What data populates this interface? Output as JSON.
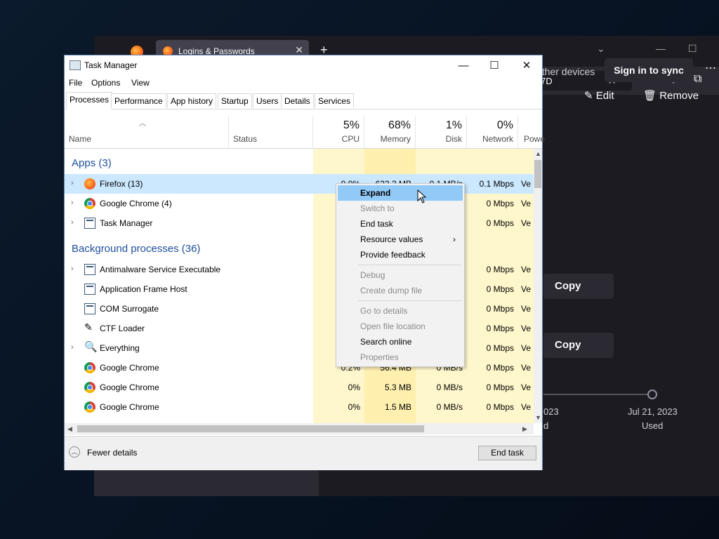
{
  "firefox": {
    "tab_title": "Logins & Passwords",
    "url_fragment": "7D",
    "other_devices": "other devices",
    "sign_in_sync": "Sign in to sync",
    "edit": "Edit",
    "remove": "Remove",
    "copy1": "Copy",
    "copy2": "Copy",
    "date_left": "023",
    "date_left_sub": "d",
    "date_right": "Jul 21, 2023",
    "date_right_sub": "Used"
  },
  "taskmanager": {
    "title": "Task Manager",
    "menu": [
      "File",
      "Options",
      "View"
    ],
    "tabs": [
      "Processes",
      "Performance",
      "App history",
      "Startup",
      "Users",
      "Details",
      "Services"
    ],
    "columns": {
      "name": "Name",
      "status": "Status",
      "cpu_pct": "5%",
      "cpu": "CPU",
      "mem_pct": "68%",
      "mem": "Memory",
      "disk_pct": "1%",
      "disk": "Disk",
      "net_pct": "0%",
      "net": "Network",
      "power": "Powe"
    },
    "group_apps": "Apps (3)",
    "group_bg": "Background processes (36)",
    "rows": [
      {
        "name": "Firefox (13)",
        "cpu": "0.0%",
        "mem": "633.3 MB",
        "disk": "0.1 MB/s",
        "net": "0.1 Mbps",
        "power": "Ve"
      },
      {
        "name": "Google Chrome (4)",
        "cpu": "",
        "mem": "",
        "disk": "",
        "net": "0 Mbps",
        "power": "Ve"
      },
      {
        "name": "Task Manager",
        "cpu": "",
        "mem": "",
        "disk": "",
        "net": "0 Mbps",
        "power": "Ve"
      },
      {
        "name": "Antimalware Service Executable",
        "cpu": "",
        "mem": "",
        "disk": "",
        "net": "0 Mbps",
        "power": "Ve"
      },
      {
        "name": "Application Frame Host",
        "cpu": "",
        "mem": "",
        "disk": "",
        "net": "0 Mbps",
        "power": "Ve"
      },
      {
        "name": "COM Surrogate",
        "cpu": "",
        "mem": "",
        "disk": "",
        "net": "0 Mbps",
        "power": "Ve"
      },
      {
        "name": "CTF Loader",
        "cpu": "",
        "mem": "",
        "disk": "",
        "net": "0 Mbps",
        "power": "Ve"
      },
      {
        "name": "Everything",
        "cpu": "",
        "mem": "",
        "disk": "",
        "net": "0 Mbps",
        "power": "Ve"
      },
      {
        "name": "Google Chrome",
        "cpu": "0.2%",
        "mem": "56.4 MB",
        "disk": "0 MB/s",
        "net": "0 Mbps",
        "power": "Ve"
      },
      {
        "name": "Google Chrome",
        "cpu": "0%",
        "mem": "5.3 MB",
        "disk": "0 MB/s",
        "net": "0 Mbps",
        "power": "Ve"
      },
      {
        "name": "Google Chrome",
        "cpu": "0%",
        "mem": "1.5 MB",
        "disk": "0 MB/s",
        "net": "0 Mbps",
        "power": "Ve"
      }
    ],
    "fewer_details": "Fewer details",
    "end_task": "End task"
  },
  "context_menu": {
    "expand": "Expand",
    "switch_to": "Switch to",
    "end_task": "End task",
    "resource_values": "Resource values",
    "provide_feedback": "Provide feedback",
    "debug": "Debug",
    "create_dump": "Create dump file",
    "go_to_details": "Go to details",
    "open_file_location": "Open file location",
    "search_online": "Search online",
    "properties": "Properties"
  }
}
